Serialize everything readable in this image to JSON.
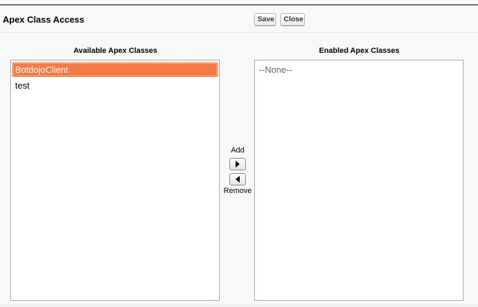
{
  "header": {
    "title": "Apex Class Access",
    "save_label": "Save",
    "close_label": "Close"
  },
  "available": {
    "label": "Available Apex Classes",
    "items": [
      "BotdojoClient",
      "test"
    ],
    "selected": "BotdojoClient"
  },
  "enabled": {
    "label": "Enabled Apex Classes",
    "items": [
      "--None--"
    ]
  },
  "mover": {
    "add_label": "Add",
    "remove_label": "Remove",
    "add_icon": "arrow-right-icon",
    "remove_icon": "arrow-left-icon"
  },
  "colors": {
    "selected_bg": "#f47b46",
    "selected_text": "#ffffff"
  }
}
